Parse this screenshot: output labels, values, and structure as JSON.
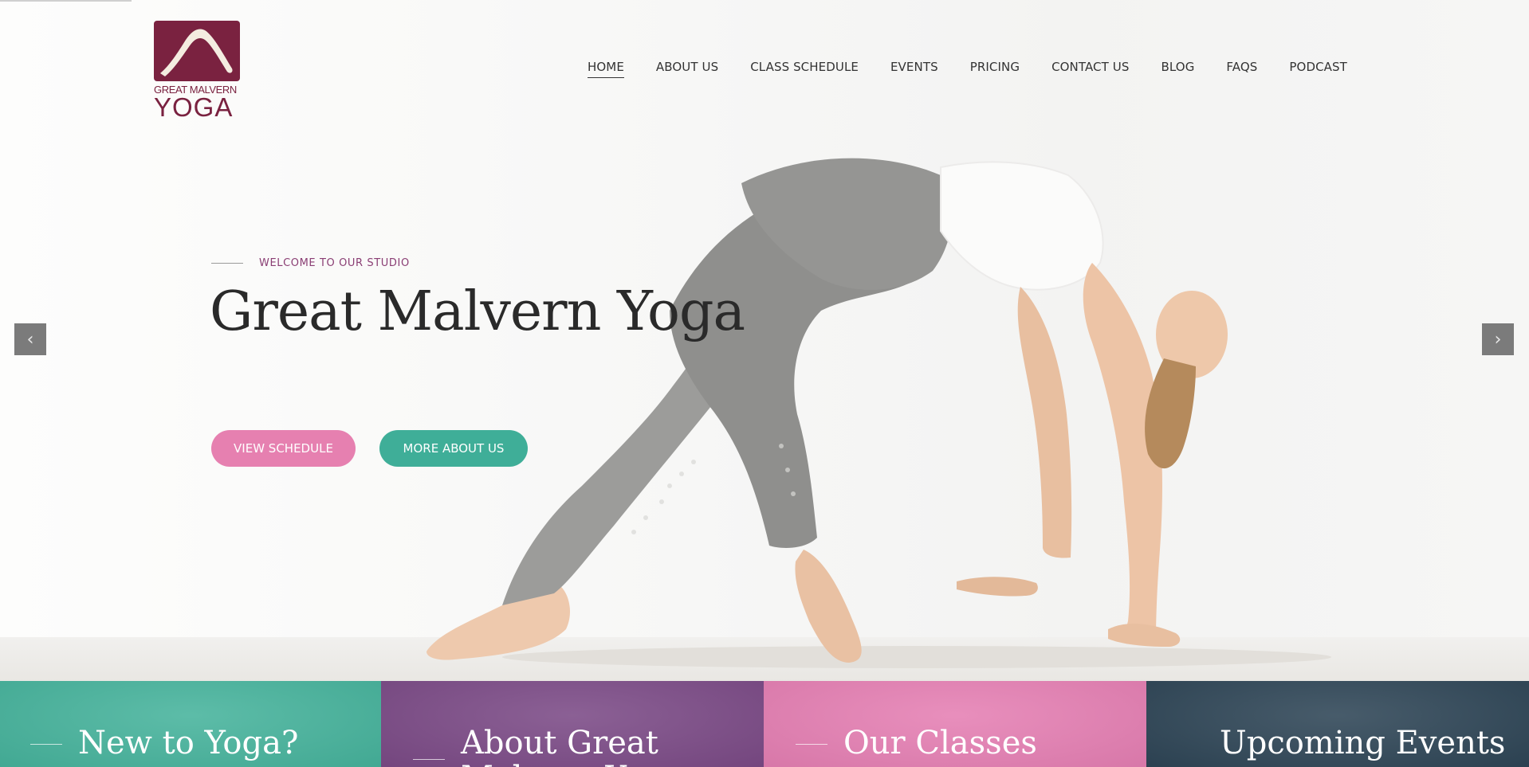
{
  "logo": {
    "line1": "GREAT MALVERN",
    "line2": "YOGA"
  },
  "nav": {
    "items": [
      {
        "label": "HOME"
      },
      {
        "label": "ABOUT US"
      },
      {
        "label": "CLASS SCHEDULE"
      },
      {
        "label": "EVENTS"
      },
      {
        "label": "PRICING"
      },
      {
        "label": "CONTACT US"
      },
      {
        "label": "BLOG"
      },
      {
        "label": "FAQS"
      },
      {
        "label": "PODCAST"
      }
    ]
  },
  "hero": {
    "eyebrow": "WELCOME TO OUR STUDIO",
    "title": "Great Malvern Yoga",
    "buttons": {
      "schedule": "VIEW SCHEDULE",
      "about": "MORE ABOUT US"
    },
    "prev_arrow": "‹",
    "next_arrow": "›"
  },
  "tiles": [
    {
      "title": "New to Yoga?"
    },
    {
      "title": "About Great Malvern Yoga"
    },
    {
      "title": "Our Classes"
    },
    {
      "title": "Upcoming Events"
    }
  ],
  "colors": {
    "brand": "#7a2240",
    "pink": "#e680b0",
    "teal": "#3fae98",
    "purple": "#7b4a86",
    "navy": "#2e4556"
  },
  "icons": {
    "prev": "chevron-left-icon",
    "next": "chevron-right-icon"
  }
}
